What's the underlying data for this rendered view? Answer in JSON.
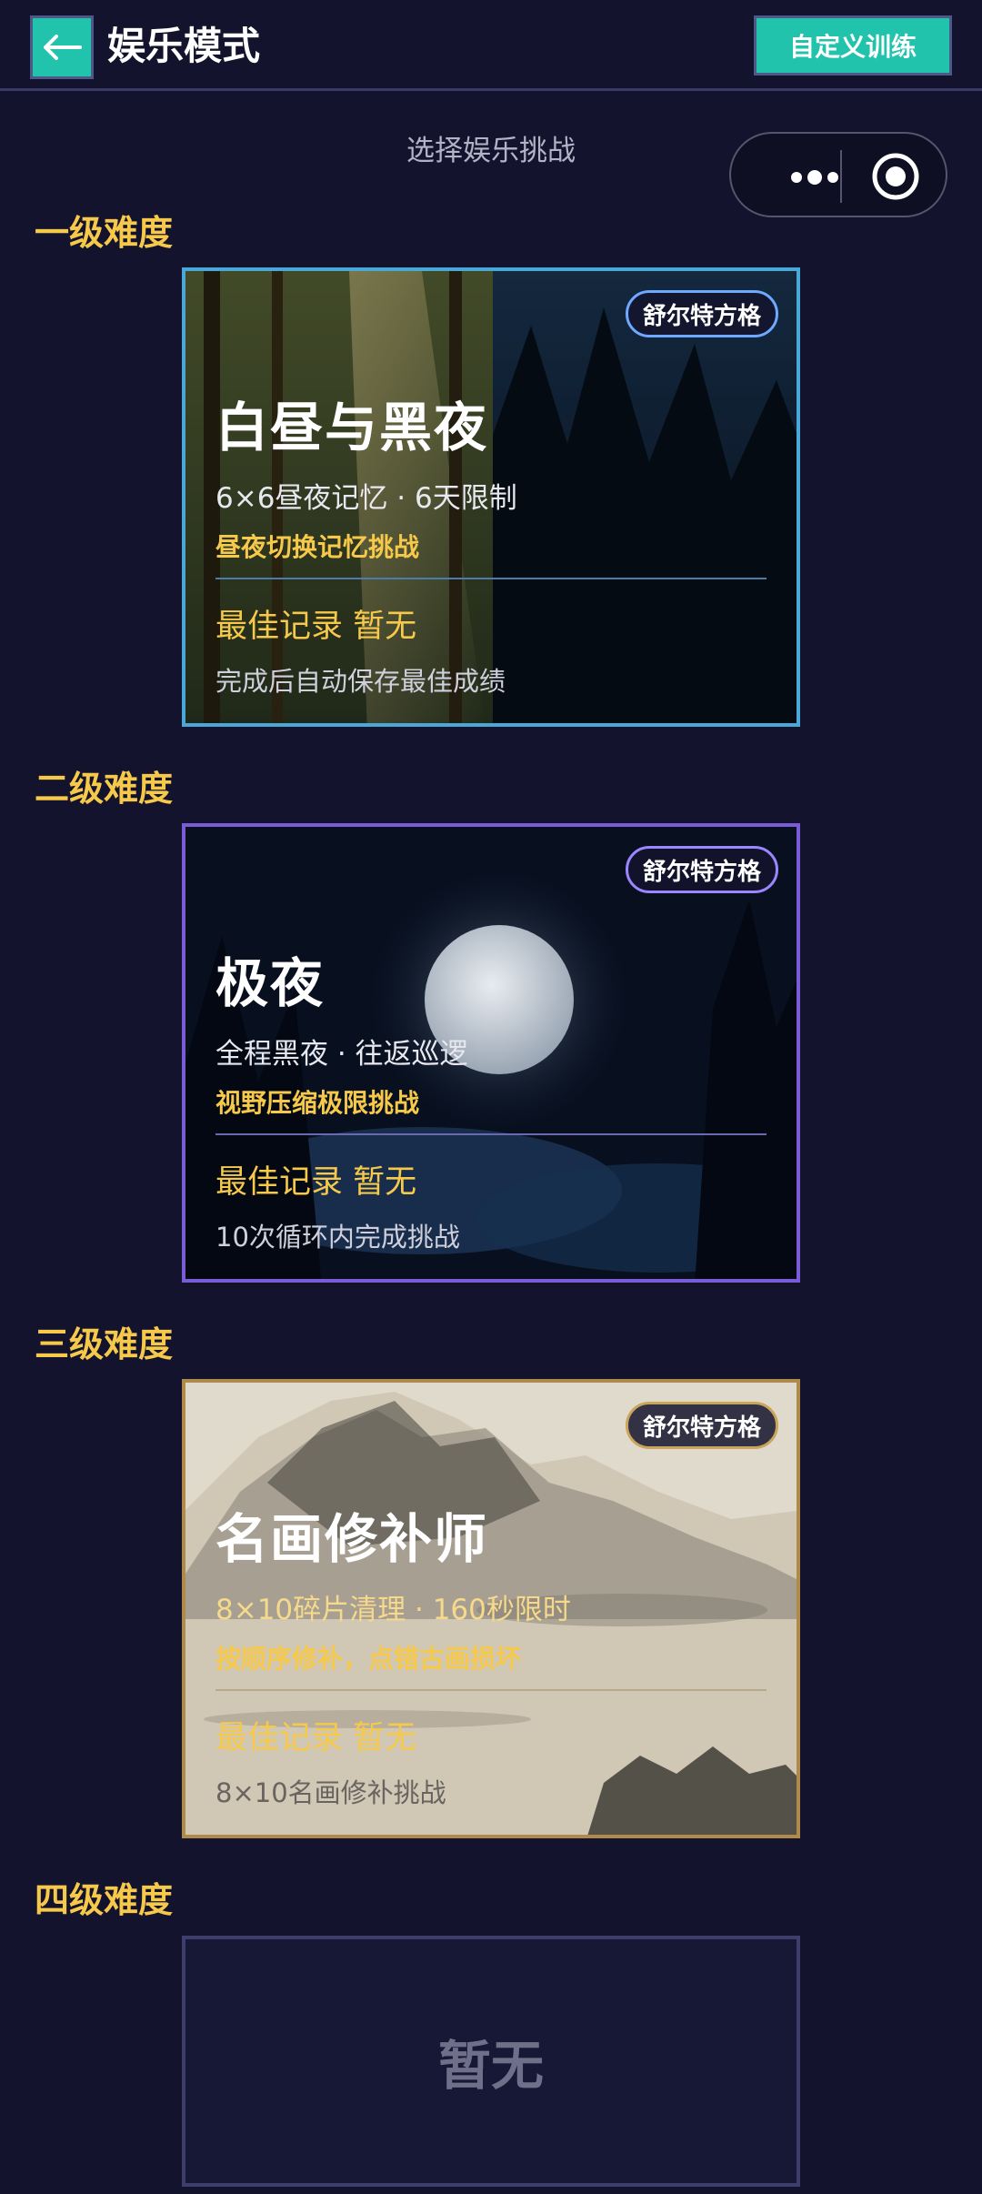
{
  "header": {
    "title": "娱乐模式",
    "custom_training_label": "自定义训练"
  },
  "subtitle": "选择娱乐挑战",
  "levels": [
    {
      "title": "一级难度",
      "card": {
        "tag": "舒尔特方格",
        "name": "白昼与黑夜",
        "desc": "6×6昼夜记忆 · 6天限制",
        "hint": "昼夜切换记忆挑战",
        "record": "最佳记录 暂无",
        "note": "完成后自动保存最佳成绩",
        "border_color": "#4aa8d8"
      }
    },
    {
      "title": "二级难度",
      "card": {
        "tag": "舒尔特方格",
        "name": "极夜",
        "desc": "全程黑夜 · 往返巡逻",
        "hint": "视野压缩极限挑战",
        "record": "最佳记录 暂无",
        "note": "10次循环内完成挑战",
        "border_color": "#7a5cd6"
      }
    },
    {
      "title": "三级难度",
      "card": {
        "tag": "舒尔特方格",
        "name": "名画修补师",
        "desc": "8×10碎片清理 · 160秒限时",
        "hint": "按顺序修补，点错古画损坏",
        "record": "最佳记录 暂无",
        "note": "8×10名画修补挑战",
        "border_color": "#b08a4a"
      }
    },
    {
      "title": "四级难度",
      "empty_label": "暂无"
    }
  ],
  "colors": {
    "background": "#13132d",
    "accent": "#22c3ad",
    "level_title": "#f6c94b"
  },
  "icons": {
    "back": "arrow-left-icon",
    "more": "more-dots-icon",
    "close": "target-circle-icon"
  }
}
